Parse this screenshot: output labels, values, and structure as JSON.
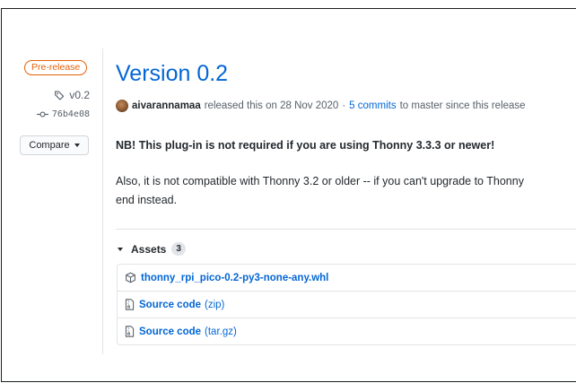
{
  "sidebar": {
    "prerelease_label": "Pre-release",
    "tag_label": "v0.2",
    "commit_label": "76b4e08",
    "compare_label": "Compare"
  },
  "release": {
    "title": "Version 0.2",
    "author": "aivarannamaa",
    "released_text": "released this on 28 Nov 2020",
    "separator": "·",
    "commits_link": "5 commits",
    "commits_suffix": "to master since this release",
    "note_bold": "NB! This plug-in is not required if you are using Thonny 3.3.3 or newer!",
    "body_line1": "Also, it is not compatible with Thonny 3.2 or older -- if you can't upgrade to Thonny",
    "body_line2": "end instead."
  },
  "assets": {
    "heading": "Assets",
    "count": "3",
    "items": [
      {
        "name": "thonny_rpi_pico-0.2-py3-none-any.whl",
        "suffix": ""
      },
      {
        "name": "Source code",
        "suffix": "(zip)"
      },
      {
        "name": "Source code",
        "suffix": "(tar.gz)"
      }
    ]
  },
  "colors": {
    "link": "#0366d6",
    "prerelease": "#e36209",
    "muted": "#586069"
  }
}
